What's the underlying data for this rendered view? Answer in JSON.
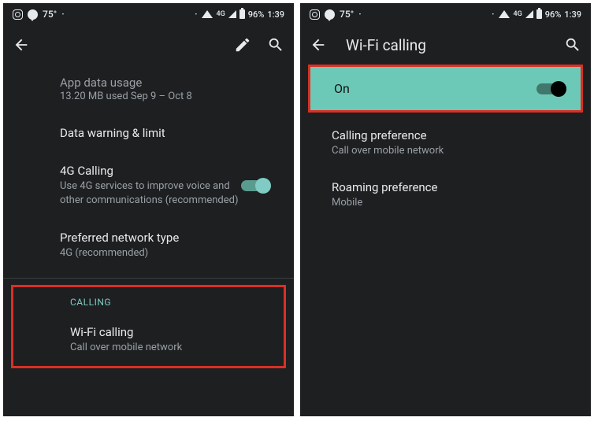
{
  "statusbar": {
    "temp": "75°",
    "conn_type": "4G",
    "battery_pct": "96%",
    "time": "1:39"
  },
  "left_screen": {
    "app_data_usage": {
      "title": "App data usage",
      "subtitle": "13.20 MB used Sep 9 – Oct 8"
    },
    "data_warning": {
      "title": "Data warning & limit"
    },
    "four_g_calling": {
      "title": "4G Calling",
      "subtitle": "Use 4G services to improve voice and other communications (recommended)"
    },
    "preferred_network": {
      "title": "Preferred network type",
      "subtitle": "4G (recommended)"
    },
    "calling_header": "CALLING",
    "wifi_calling": {
      "title": "Wi-Fi calling",
      "subtitle": "Call over mobile network"
    }
  },
  "right_screen": {
    "page_title": "Wi-Fi calling",
    "on_toggle": {
      "label": "On"
    },
    "calling_pref": {
      "title": "Calling preference",
      "subtitle": "Call over mobile network"
    },
    "roaming_pref": {
      "title": "Roaming preference",
      "subtitle": "Mobile"
    }
  }
}
